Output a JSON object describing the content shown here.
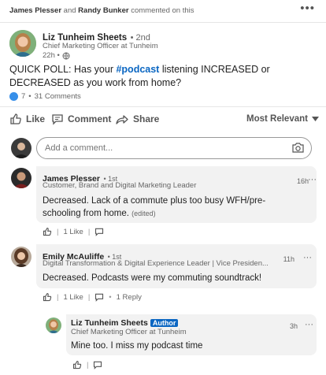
{
  "context": {
    "user1": "James Plesser",
    "conj": "and",
    "user2": "Randy Bunker",
    "suffix": "commented on this",
    "more_icon": "more-horizontal-icon"
  },
  "post": {
    "author": "Liz Tunheim Sheets",
    "degree": "• 2nd",
    "headline": "Chief Marketing Officer at Tunheim",
    "time": "22h •",
    "text_before": "QUICK POLL: Has your ",
    "hashtag": "#podcast",
    "text_after": " listening INCREASED or DECREASED as you work from home?",
    "reaction_count": "7",
    "comments_count": "31 Comments"
  },
  "actions": {
    "like": "Like",
    "comment": "Comment",
    "share": "Share",
    "sort": "Most Relevant"
  },
  "comment_input": {
    "placeholder": "Add a comment..."
  },
  "comments": [
    {
      "author": "James Plesser",
      "degree": "• 1st",
      "headline": "Customer, Brand and Digital Marketing Leader",
      "time": "16h",
      "text": "Decreased. Lack of a commute plus too busy WFH/pre-schooling from home.",
      "edited": "(edited)",
      "likes": "1 Like"
    },
    {
      "author": "Emily McAuliffe",
      "degree": "• 1st",
      "headline": "Digital Transformation & Digital Experience Leader | Vice Presiden...",
      "time": "11h",
      "text": "Decreased. Podcasts were my commuting soundtrack!",
      "likes": "1 Like",
      "replies": "1 Reply"
    }
  ],
  "reply": {
    "author": "Liz Tunheim Sheets",
    "badge": "Author",
    "headline": "Chief Marketing Officer at Tunheim",
    "time": "3h",
    "text": "Mine too. I miss my podcast time"
  },
  "colors": {
    "link_blue": "#0a66c2",
    "bubble_bg": "#f2f2f2",
    "author_badge": "#0a66c2"
  }
}
